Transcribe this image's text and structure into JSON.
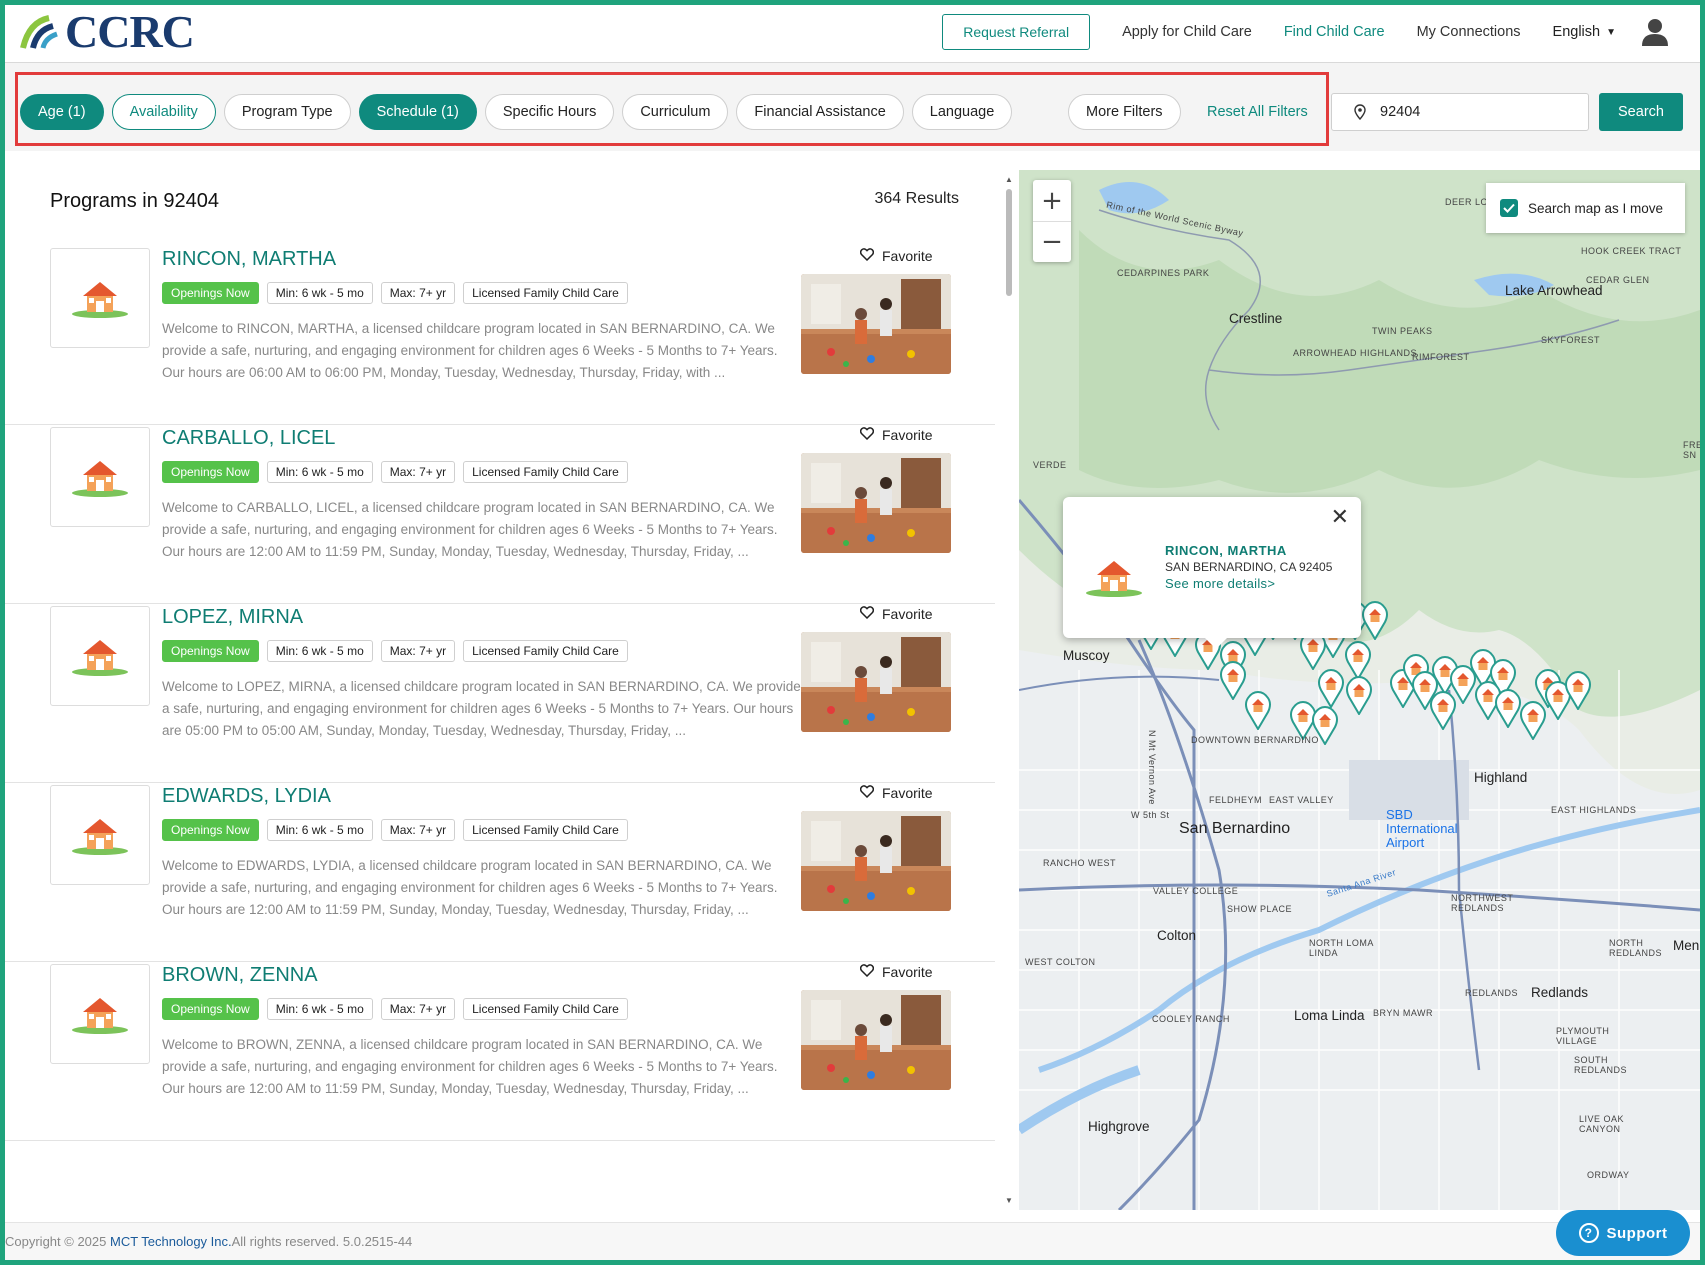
{
  "header": {
    "logo": "CCRC",
    "nav": {
      "request_referral": "Request Referral",
      "apply": "Apply for Child Care",
      "find": "Find Child Care",
      "connections": "My Connections",
      "language": "English"
    }
  },
  "filters": {
    "pills": [
      "Age (1)",
      "Availability",
      "Program Type",
      "Schedule (1)",
      "Specific Hours",
      "Curriculum",
      "Financial Assistance",
      "Language"
    ],
    "more_filters": "More Filters",
    "reset_all": "Reset All Filters",
    "location_value": "92404",
    "search_button": "Search"
  },
  "list": {
    "title": "Programs in 92404",
    "results": "364 Results",
    "favorite_label": "Favorite",
    "programs": [
      {
        "name": "RINCON, MARTHA",
        "status": "Openings Now",
        "min": "Min: 6 wk - 5 mo",
        "max": "Max: 7+ yr",
        "type": "Licensed Family Child Care",
        "description": "Welcome to RINCON, MARTHA, a licensed childcare program located in SAN BERNARDINO, CA. We provide a safe, nurturing, and engaging environment for children ages 6 Weeks - 5 Months to 7+ Years. Our hours are 06:00 AM to 06:00 PM, Monday, Tuesday, Wednesday, Thursday, Friday, with ..."
      },
      {
        "name": "CARBALLO, LICEL",
        "status": "Openings Now",
        "min": "Min: 6 wk - 5 mo",
        "max": "Max: 7+ yr",
        "type": "Licensed Family Child Care",
        "description": "Welcome to CARBALLO, LICEL, a licensed childcare program located in SAN BERNARDINO, CA. We provide a safe, nurturing, and engaging environment for children ages 6 Weeks - 5 Months to 7+ Years. Our hours are 12:00 AM to 11:59 PM, Sunday, Monday, Tuesday, Wednesday, Thursday, Friday, ..."
      },
      {
        "name": "LOPEZ, MIRNA",
        "status": "Openings Now",
        "min": "Min: 6 wk - 5 mo",
        "max": "Max: 7+ yr",
        "type": "Licensed Family Child Care",
        "description": "Welcome to LOPEZ, MIRNA, a licensed childcare program located in SAN BERNARDINO, CA. We provide a safe, nurturing, and engaging environment for children ages 6 Weeks - 5 Months to 7+ Years. Our hours are 05:00 PM to 05:00 AM, Sunday, Monday, Tuesday, Wednesday, Thursday, Friday, ..."
      },
      {
        "name": "EDWARDS, LYDIA",
        "status": "Openings Now",
        "min": "Min: 6 wk - 5 mo",
        "max": "Max: 7+ yr",
        "type": "Licensed Family Child Care",
        "description": "Welcome to EDWARDS, LYDIA, a licensed childcare program located in SAN BERNARDINO, CA. We provide a safe, nurturing, and engaging environment for children ages 6 Weeks - 5 Months to 7+ Years. Our hours are 12:00 AM to 11:59 PM, Sunday, Monday, Tuesday, Wednesday, Thursday, Friday, ..."
      },
      {
        "name": "BROWN, ZENNA",
        "status": "Openings Now",
        "min": "Min: 6 wk - 5 mo",
        "max": "Max: 7+ yr",
        "type": "Licensed Family Child Care",
        "description": "Welcome to BROWN, ZENNA, a licensed childcare program located in SAN BERNARDINO, CA. We provide a safe, nurturing, and engaging environment for children ages 6 Weeks - 5 Months to 7+ Years. Our hours are 12:00 AM to 11:59 PM, Sunday, Monday, Tuesday, Wednesday, Thursday, Friday, ..."
      }
    ]
  },
  "map": {
    "search_as_move": "Search map as I move",
    "zoom_in": "+",
    "zoom_out": "−",
    "popup": {
      "name": "RINCON, MARTHA",
      "address": "SAN BERNARDINO, CA 92405",
      "link": "See more details>"
    },
    "labels": [
      "Rim of the World Scenic Byway",
      "Crestline",
      "CEDARPINES PARK",
      "Lake Arrowhead",
      "TWIN PEAKS",
      "ARROWHEAD HIGHLANDS",
      "RIMFOREST",
      "SKYFOREST",
      "HOOK CREEK TRACT",
      "CEDAR GLEN",
      "DEER LODGE",
      "Muscoy",
      "DOWNTOWN BERNARDINO",
      "FELDHEYM",
      "EAST VALLEY",
      "San Bernardino",
      "SBD International Airport",
      "EAST HIGHLANDS",
      "RANCHO WEST",
      "VALLEY COLLEGE",
      "SHOW PLACE",
      "Colton",
      "NORTH LOMA LINDA",
      "NORTHWEST REDLANDS",
      "NORTH REDLANDS",
      "WEST COLTON",
      "REDLANDS",
      "Redlands",
      "COOLEY RANCH",
      "Loma Linda",
      "BRYN MAWR",
      "PLYMOUTH VILLAGE",
      "SOUTH REDLANDS",
      "Highgrove",
      "LIVE OAK CANYON",
      "ORDWAY",
      "N Mt Vernon Ave",
      "W 5th St",
      "Santa Ana River",
      "Highland",
      "VERDE",
      "Men",
      "FRE SN"
    ]
  },
  "footer": {
    "copyright": "Copyright © 2025 ",
    "brand": "MCT Technology Inc.",
    "rights": "All rights reserved. 5.0.2515-44"
  },
  "support": "Support",
  "colors": {
    "primary": "#0f8a7e",
    "highlight_border": "#e23b3b",
    "openings": "#55c24a",
    "frame": "#1fa37c"
  }
}
